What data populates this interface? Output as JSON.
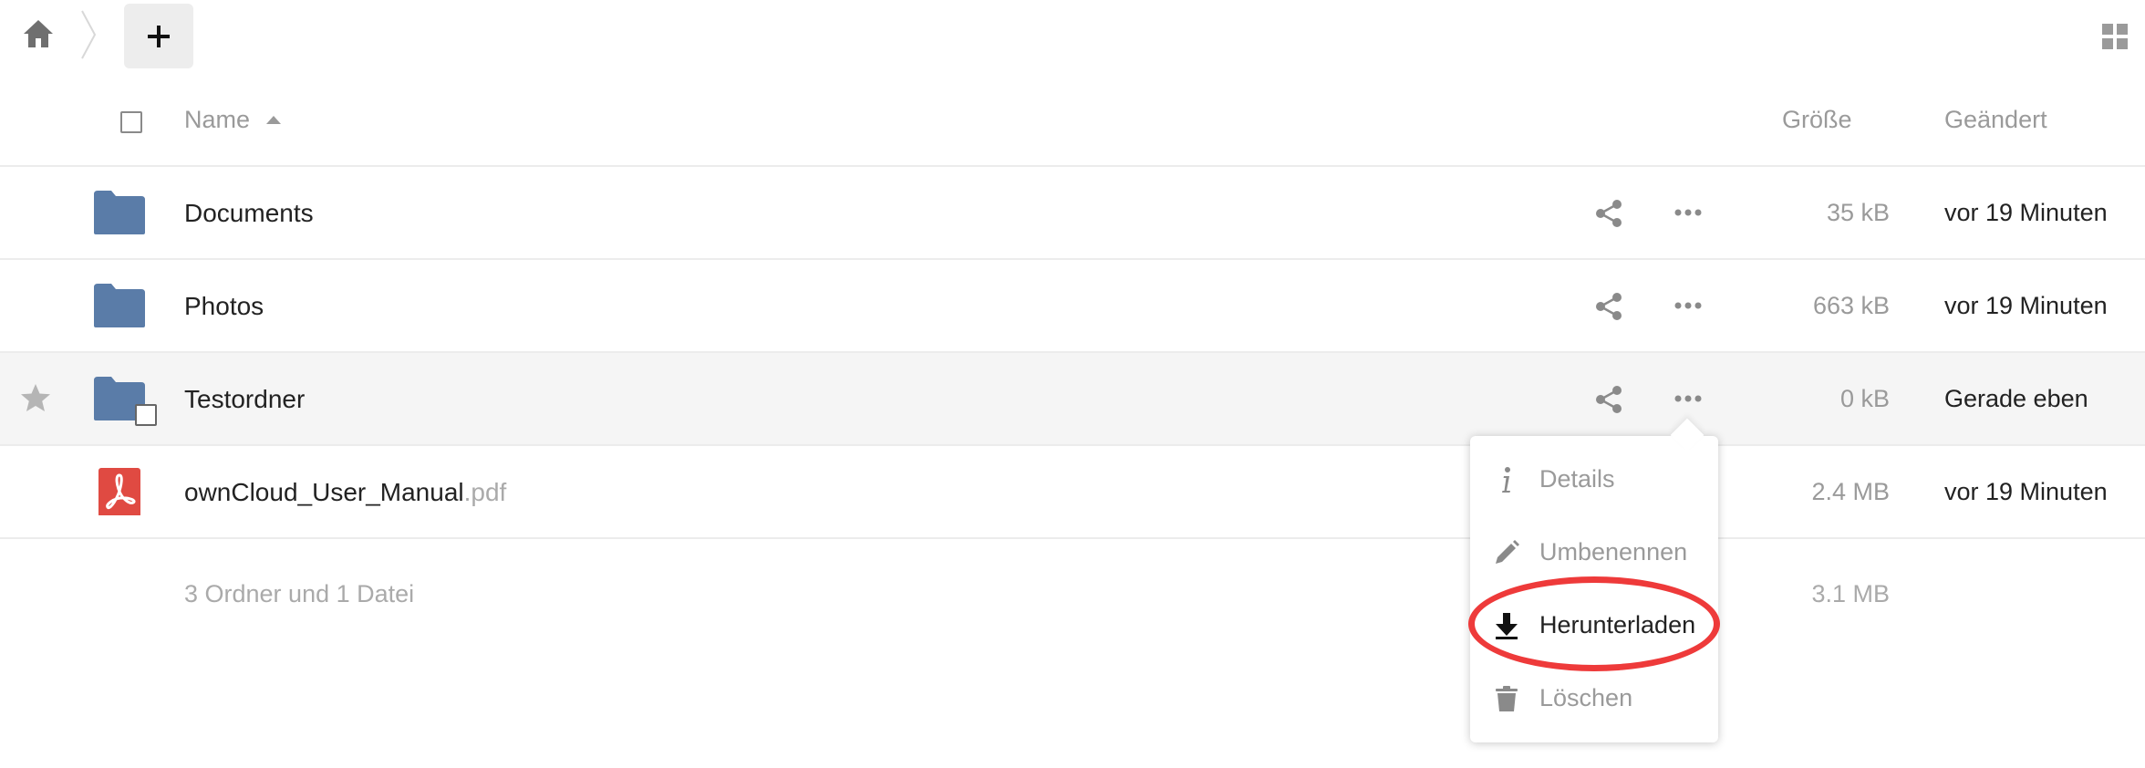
{
  "header": {
    "name_label": "Name",
    "size_label": "Größe",
    "modified_label": "Geändert",
    "new_label": "+"
  },
  "files": [
    {
      "name": "Documents",
      "ext": "",
      "size": "35 kB",
      "modified": "vor 19 Minuten",
      "type": "folder"
    },
    {
      "name": "Photos",
      "ext": "",
      "size": "663 kB",
      "modified": "vor 19 Minuten",
      "type": "folder"
    },
    {
      "name": "Testordner",
      "ext": "",
      "size": "0 kB",
      "modified": "Gerade eben",
      "type": "folder"
    },
    {
      "name": "ownCloud_User_Manual",
      "ext": ".pdf",
      "size": "2.4 MB",
      "modified": "vor 19 Minuten",
      "type": "pdf"
    }
  ],
  "summary": {
    "text": "3 Ordner und 1 Datei",
    "total_size": "3.1 MB"
  },
  "menu": {
    "items": [
      {
        "label": "Details",
        "icon": "info-icon"
      },
      {
        "label": "Umbenennen",
        "icon": "pencil-icon"
      },
      {
        "label": "Herunterladen",
        "icon": "download-icon"
      },
      {
        "label": "Löschen",
        "icon": "trash-icon"
      }
    ]
  },
  "colors": {
    "folder": "#5a7ca8",
    "pdf": "#e04a42",
    "highlight": "#ee3a3a"
  }
}
